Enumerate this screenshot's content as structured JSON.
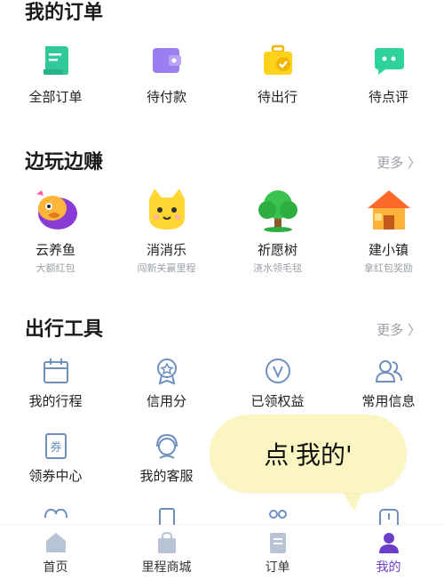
{
  "orders": {
    "title": "我的订单",
    "items": [
      {
        "label": "全部订单",
        "icon": "document-icon"
      },
      {
        "label": "待付款",
        "icon": "wallet-icon"
      },
      {
        "label": "待出行",
        "icon": "suitcase-check-icon"
      },
      {
        "label": "待点评",
        "icon": "chat-bubble-icon"
      }
    ]
  },
  "earn": {
    "title": "边玩边赚",
    "more": "更多 〉",
    "items": [
      {
        "label": "云养鱼",
        "sub": "大额红包",
        "icon": "fish-icon"
      },
      {
        "label": "消消乐",
        "sub": "闯新关赢里程",
        "icon": "cat-icon"
      },
      {
        "label": "祈愿树",
        "sub": "浇水领毛毯",
        "icon": "tree-icon"
      },
      {
        "label": "建小镇",
        "sub": "拿红包奖励",
        "icon": "house-icon"
      }
    ]
  },
  "tools": {
    "title": "出行工具",
    "more": "更多 〉",
    "row1": [
      {
        "label": "我的行程",
        "icon": "calendar-icon"
      },
      {
        "label": "信用分",
        "icon": "medal-icon"
      },
      {
        "label": "已领权益",
        "icon": "v-badge-icon"
      },
      {
        "label": "常用信息",
        "icon": "contacts-icon"
      }
    ],
    "row2": [
      {
        "label": "领券中心",
        "icon": "coupon-icon"
      },
      {
        "label": "我的客服",
        "icon": "headset-icon"
      }
    ]
  },
  "tooltip": {
    "text": "点'我的'"
  },
  "tabbar": {
    "items": [
      {
        "label": "首页",
        "icon": "home-icon"
      },
      {
        "label": "里程商城",
        "icon": "shopping-bag-icon"
      },
      {
        "label": "订单",
        "icon": "order-list-icon"
      },
      {
        "label": "我的",
        "icon": "user-icon"
      }
    ],
    "active_color": "#6b3ec9"
  }
}
